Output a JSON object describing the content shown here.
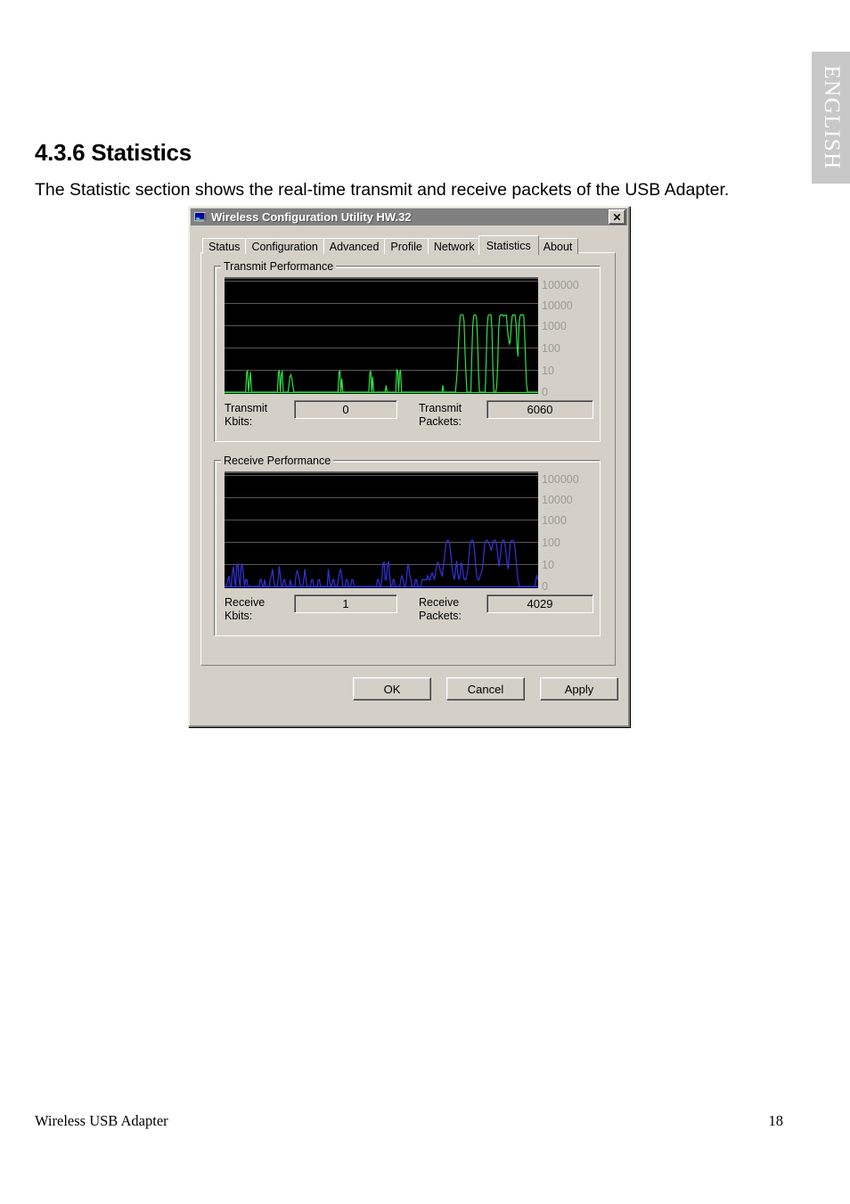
{
  "page": {
    "side_tab": "ENGLISH",
    "heading": "4.3.6 Statistics",
    "intro": "The Statistic section shows the real-time transmit and receive packets of the USB Adapter.",
    "footer_left": "Wireless USB Adapter",
    "footer_right": "18"
  },
  "dialog": {
    "title": "Wireless Configuration Utility HW.32",
    "title_icon": "computer-monitor-icon",
    "close_label": "✕",
    "tabs": [
      {
        "label": "Status",
        "active": false
      },
      {
        "label": "Configuration",
        "active": false
      },
      {
        "label": "Advanced",
        "active": false
      },
      {
        "label": "Profile",
        "active": false
      },
      {
        "label": "Network",
        "active": false
      },
      {
        "label": "Statistics",
        "active": true
      },
      {
        "label": "About",
        "active": false
      }
    ],
    "buttons": [
      {
        "label": "OK"
      },
      {
        "label": "Cancel"
      },
      {
        "label": "Apply"
      }
    ],
    "transmit": {
      "group_title": "Transmit Performance",
      "kbits_label_line1": "Transmit",
      "kbits_label_line2": "Kbits:",
      "kbits_value": "0",
      "packets_label_line1": "Transmit",
      "packets_label_line2": "Packets:",
      "packets_value": "6060"
    },
    "receive": {
      "group_title": "Receive Performance",
      "kbits_label_line1": "Receive",
      "kbits_label_line2": "Kbits:",
      "kbits_value": "1",
      "packets_label_line1": "Receive",
      "packets_label_line2": "Packets:",
      "packets_value": "4029"
    },
    "colors": {
      "dialog_face": "#d4d0c8",
      "titlebar": "#808080",
      "plot_background": "#000000",
      "gridline": "#585858",
      "axis_label": "#9b9b93",
      "transmit_trace": "#33dd44",
      "receive_trace": "#3333dd"
    }
  },
  "chart_data": [
    {
      "type": "line",
      "title": "Transmit Performance",
      "xlabel": "",
      "ylabel": "",
      "yscale": "log",
      "ytick_labels": [
        "100000",
        "10000",
        "1000",
        "100",
        "10",
        "0"
      ],
      "ylim": [
        0,
        100000
      ],
      "grid": true,
      "legend": "none",
      "trace_color": "#33dd44",
      "series": [
        {
          "name": "Transmit Kbits",
          "values": [
            0,
            0,
            0,
            0,
            0,
            0,
            0,
            0,
            0,
            0,
            0,
            0,
            0,
            0,
            0,
            0,
            0,
            0,
            0,
            0,
            0,
            0,
            0,
            8,
            9,
            0,
            3,
            8,
            0,
            0,
            0,
            0,
            0,
            0,
            0,
            0,
            0,
            0,
            0,
            0,
            0,
            0,
            0,
            0,
            0,
            0,
            0,
            0,
            0,
            0,
            0,
            0,
            0,
            0,
            0,
            0,
            8,
            9,
            0,
            6,
            9,
            0,
            0,
            0,
            0,
            0,
            0,
            2,
            5,
            6,
            4,
            2,
            0,
            0,
            0,
            0,
            0,
            0,
            0,
            0,
            0,
            0,
            0,
            0,
            0,
            0,
            0,
            0,
            0,
            0,
            0,
            0,
            0,
            0,
            0,
            0,
            0,
            0,
            0,
            0,
            0,
            0,
            0,
            0,
            0,
            0,
            0,
            0,
            0,
            0,
            0,
            0,
            0,
            0,
            0,
            0,
            0,
            0,
            0,
            8,
            9,
            0,
            4,
            0,
            0,
            0,
            0,
            0,
            0,
            0,
            0,
            0,
            0,
            0,
            0,
            0,
            0,
            0,
            0,
            0,
            0,
            0,
            0,
            0,
            0,
            0,
            0,
            0,
            0,
            0,
            0,
            7,
            9,
            0,
            5,
            0,
            0,
            0,
            0,
            0,
            0,
            0,
            0,
            0,
            0,
            0,
            0,
            1,
            2,
            1,
            0,
            0,
            0,
            0,
            0,
            0,
            0,
            0,
            0,
            10,
            9,
            0,
            8,
            9,
            0,
            0,
            0,
            0,
            0,
            0,
            0,
            0,
            0,
            0,
            0,
            0,
            0,
            0,
            0,
            0,
            0,
            0,
            0,
            0,
            0,
            0,
            0,
            0,
            0,
            0,
            0,
            0,
            0,
            0,
            0,
            0,
            0,
            0,
            0,
            0,
            0,
            0,
            0,
            0,
            0,
            1,
            1,
            2,
            0,
            0,
            0,
            0,
            0,
            0,
            0,
            0,
            0,
            0,
            0,
            0,
            1,
            3,
            10,
            90,
            700,
            2600,
            3000,
            3000,
            2900,
            1400,
            60,
            6,
            1,
            0,
            0,
            0,
            1,
            40,
            900,
            2700,
            3000,
            2900,
            2000,
            200,
            8,
            0,
            0,
            0,
            0,
            0,
            0,
            1,
            30,
            800,
            2600,
            3000,
            3000,
            2900,
            600,
            9,
            0,
            0,
            1,
            2,
            20,
            700,
            2500,
            3000,
            2900,
            3000,
            2600,
            2700,
            2900,
            2800,
            700,
            300,
            150,
            180,
            900,
            2600,
            3000,
            2800,
            2900,
            1200,
            120,
            40,
            900,
            2500,
            3000,
            2900,
            3000,
            2700,
            400,
            20,
            2,
            0,
            0,
            0,
            0,
            0,
            0,
            0,
            0,
            0,
            0,
            0,
            0
          ]
        }
      ]
    },
    {
      "type": "line",
      "title": "Receive Performance",
      "xlabel": "",
      "ylabel": "",
      "yscale": "log",
      "ytick_labels": [
        "100000",
        "10000",
        "1000",
        "100",
        "10",
        "0"
      ],
      "ylim": [
        0,
        100000
      ],
      "grid": true,
      "legend": "none",
      "trace_color": "#3333dd",
      "series": [
        {
          "name": "Receive Kbits",
          "values": [
            0,
            1,
            1,
            2,
            3,
            1,
            1,
            4,
            8,
            2,
            1,
            9,
            10,
            2,
            1,
            8,
            9,
            3,
            1,
            2,
            2,
            1,
            1,
            1,
            1,
            0,
            1,
            1,
            1,
            1,
            1,
            1,
            2,
            2,
            1,
            1,
            2,
            1,
            1,
            1,
            1,
            2,
            3,
            6,
            2,
            1,
            1,
            1,
            2,
            8,
            3,
            1,
            1,
            2,
            2,
            1,
            1,
            1,
            1,
            2,
            1,
            1,
            1,
            1,
            3,
            5,
            4,
            2,
            1,
            1,
            1,
            2,
            6,
            2,
            1,
            1,
            1,
            1,
            2,
            2,
            1,
            1,
            1,
            1,
            2,
            2,
            1,
            1,
            1,
            1,
            1,
            1,
            1,
            6,
            2,
            1,
            1,
            2,
            2,
            1,
            1,
            1,
            2,
            4,
            6,
            3,
            1,
            1,
            1,
            2,
            2,
            1,
            1,
            1,
            2,
            2,
            1,
            1,
            1,
            1,
            1,
            1,
            1,
            1,
            1,
            1,
            1,
            1,
            1,
            1,
            1,
            1,
            1,
            1,
            1,
            1,
            1,
            2,
            2,
            1,
            1,
            2,
            11,
            12,
            2,
            2,
            9,
            13,
            3,
            1,
            1,
            2,
            2,
            1,
            1,
            1,
            1,
            1,
            2,
            3,
            2,
            1,
            1,
            2,
            8,
            9,
            3,
            2,
            1,
            1,
            1,
            2,
            2,
            1,
            1,
            1,
            1,
            2,
            2,
            2,
            2,
            2,
            3,
            2,
            2,
            3,
            4,
            3,
            2,
            4,
            8,
            12,
            10,
            6,
            4,
            3,
            7,
            20,
            60,
            100,
            120,
            110,
            60,
            20,
            6,
            3,
            2,
            6,
            14,
            4,
            2,
            3,
            12,
            8,
            3,
            2,
            2,
            3,
            6,
            25,
            70,
            110,
            120,
            100,
            40,
            8,
            3,
            2,
            2,
            3,
            4,
            6,
            20,
            70,
            110,
            120,
            110,
            80,
            60,
            40,
            70,
            110,
            120,
            110,
            60,
            20,
            8,
            20,
            70,
            110,
            120,
            100,
            40,
            12,
            6,
            20,
            80,
            115,
            120,
            110,
            70,
            20,
            6,
            2,
            1,
            1,
            1,
            1,
            1,
            1,
            1,
            1,
            1,
            1,
            1,
            1,
            1,
            1,
            1,
            2,
            3,
            2
          ]
        }
      ]
    }
  ]
}
